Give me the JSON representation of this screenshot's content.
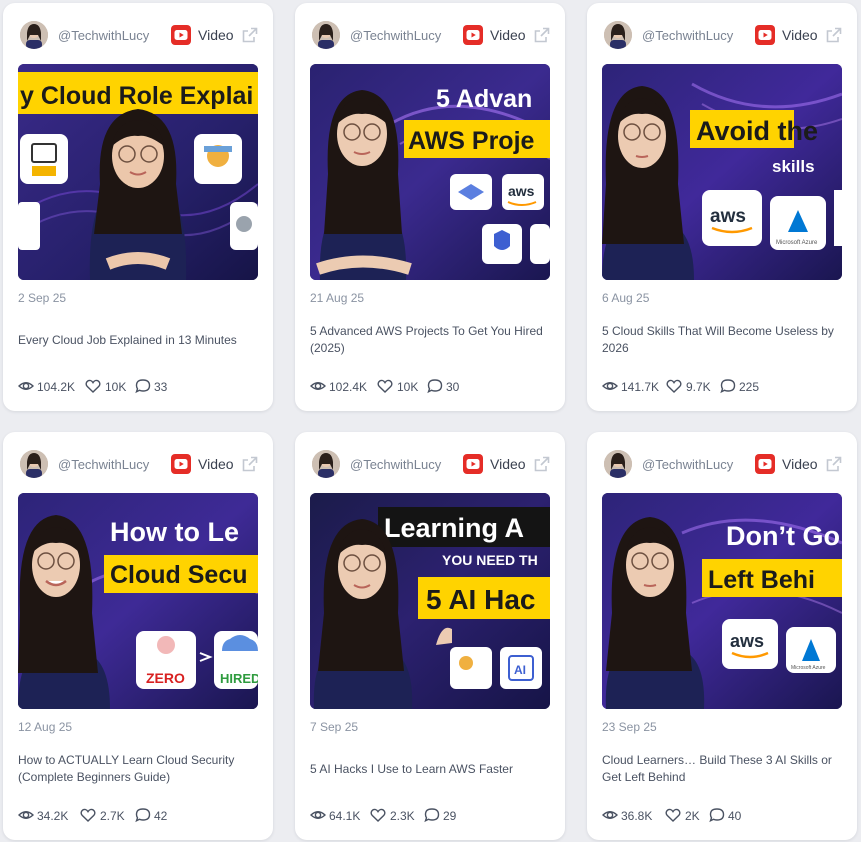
{
  "colors": {
    "page_background": "#ecedf1",
    "card_background": "#ffffff",
    "youtube_red": "#e52d27",
    "muted_text": "#8a93a2",
    "body_text": "#4a5262",
    "thumbnail_purple": "#231f5e",
    "thumbnail_banner_yellow": "#ffd300"
  },
  "cards": [
    {
      "author": "@TechwithLucy",
      "platform": "Video",
      "date": "2 Sep 25",
      "title": "Every Cloud Job Explained in 13 Minutes",
      "views": "104.2K",
      "likes": "10K",
      "comments": "33",
      "thumbnail": {
        "line1": "y Cloud Role Explai",
        "line2": "",
        "tags": []
      }
    },
    {
      "author": "@TechwithLucy",
      "platform": "Video",
      "date": "21 Aug 25",
      "title": "5 Advanced AWS Projects To Get You Hired (2025)",
      "views": "102.4K",
      "likes": "10K",
      "comments": "30",
      "thumbnail": {
        "line1": "5 Advan",
        "line2": "AWS Proje",
        "tags": [
          "aws"
        ]
      }
    },
    {
      "author": "@TechwithLucy",
      "platform": "Video",
      "date": "6 Aug 25",
      "title": "5 Cloud Skills That Will Become Useless by 2026",
      "views": "141.7K",
      "likes": "9.7K",
      "comments": "225",
      "thumbnail": {
        "line1": "Avoid the",
        "line2": "skills",
        "tags": [
          "aws",
          "Microsoft Azure"
        ]
      }
    },
    {
      "author": "@TechwithLucy",
      "platform": "Video",
      "date": "12 Aug 25",
      "title": "How to ACTUALLY Learn Cloud Security (Complete Beginners Guide)",
      "views": "34.2K",
      "likes": "2.7K",
      "comments": "42",
      "thumbnail": {
        "line1": "How to Le",
        "line2": "Cloud Secu",
        "tags": [
          "ZERO",
          "HIRED"
        ]
      }
    },
    {
      "author": "@TechwithLucy",
      "platform": "Video",
      "date": "7 Sep 25",
      "title": "5 AI Hacks I Use to Learn AWS Faster",
      "views": "64.1K",
      "likes": "2.3K",
      "comments": "29",
      "thumbnail": {
        "line1": "Learning A",
        "line2": "YOU NEED TH",
        "line3": "5 AI Hac",
        "tags": [
          "AI"
        ]
      }
    },
    {
      "author": "@TechwithLucy",
      "platform": "Video",
      "date": "23 Sep 25",
      "title": "Cloud Learners… Build These 3 AI Skills or Get Left Behind",
      "views": "36.8K",
      "likes": "2K",
      "comments": "40",
      "thumbnail": {
        "line1": "Don’t Go",
        "line2": "Left Behi",
        "tags": [
          "aws",
          "Microsoft Azure"
        ]
      }
    }
  ]
}
